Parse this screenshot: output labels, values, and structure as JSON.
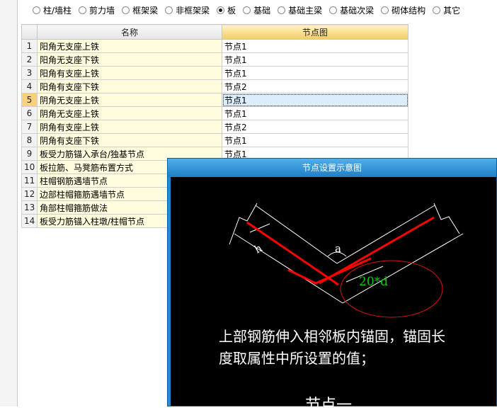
{
  "component_types": [
    {
      "label": "柱/墙柱",
      "selected": false
    },
    {
      "label": "剪力墙",
      "selected": false
    },
    {
      "label": "框架梁",
      "selected": false
    },
    {
      "label": "非框架梁",
      "selected": false
    },
    {
      "label": "板",
      "selected": true
    },
    {
      "label": "基础",
      "selected": false
    },
    {
      "label": "基础主梁",
      "selected": false
    },
    {
      "label": "基础次梁",
      "selected": false
    },
    {
      "label": "砌体结构",
      "selected": false
    },
    {
      "label": "其它",
      "selected": false
    }
  ],
  "grid": {
    "columns": [
      "名称",
      "节点图"
    ],
    "rows": [
      {
        "no": "1",
        "name": "阳角无支座上铁",
        "node": "节点1"
      },
      {
        "no": "2",
        "name": "阳角无支座下铁",
        "node": "节点1"
      },
      {
        "no": "3",
        "name": "阳角有支座上铁",
        "node": "节点1"
      },
      {
        "no": "4",
        "name": "阳角有支座下铁",
        "node": "节点2"
      },
      {
        "no": "5",
        "name": "阴角无支座上铁",
        "node": "节点1"
      },
      {
        "no": "6",
        "name": "阴角无支座上铁",
        "node": "节点1"
      },
      {
        "no": "7",
        "name": "阴角有支座上铁",
        "node": "节点2"
      },
      {
        "no": "8",
        "name": "阴角有支座下铁",
        "node": "节点1"
      },
      {
        "no": "9",
        "name": "板受力筋锚入承台/独基节点",
        "node": "节点1"
      },
      {
        "no": "10",
        "name": "板拉筋、马凳筋布置方式",
        "node": ""
      },
      {
        "no": "11",
        "name": "柱帽钢筋遇墙节点",
        "node": ""
      },
      {
        "no": "12",
        "name": "边部柱帽箍筋遇墙节点",
        "node": ""
      },
      {
        "no": "13",
        "name": "角部柱帽箍筋做法",
        "node": ""
      },
      {
        "no": "14",
        "name": "板受力筋锚入柱墩/柱帽节点",
        "node": ""
      }
    ],
    "selected_row": 4
  },
  "popup": {
    "title": "节点设置示意图",
    "labels": {
      "a": "a",
      "h": "h",
      "anchor": "20*d"
    },
    "description_line1": "上部钢筋伸入相邻板内锚固，锚固长",
    "description_line2": "度取属性中所设置的值；",
    "node_label": "节点一"
  },
  "colors": {
    "rebar": "#ff0000",
    "anchor_label": "#00cc00",
    "circle": "#e01010",
    "popup_frame": "#1f8dd6",
    "selected_index": "#f7d27a"
  }
}
